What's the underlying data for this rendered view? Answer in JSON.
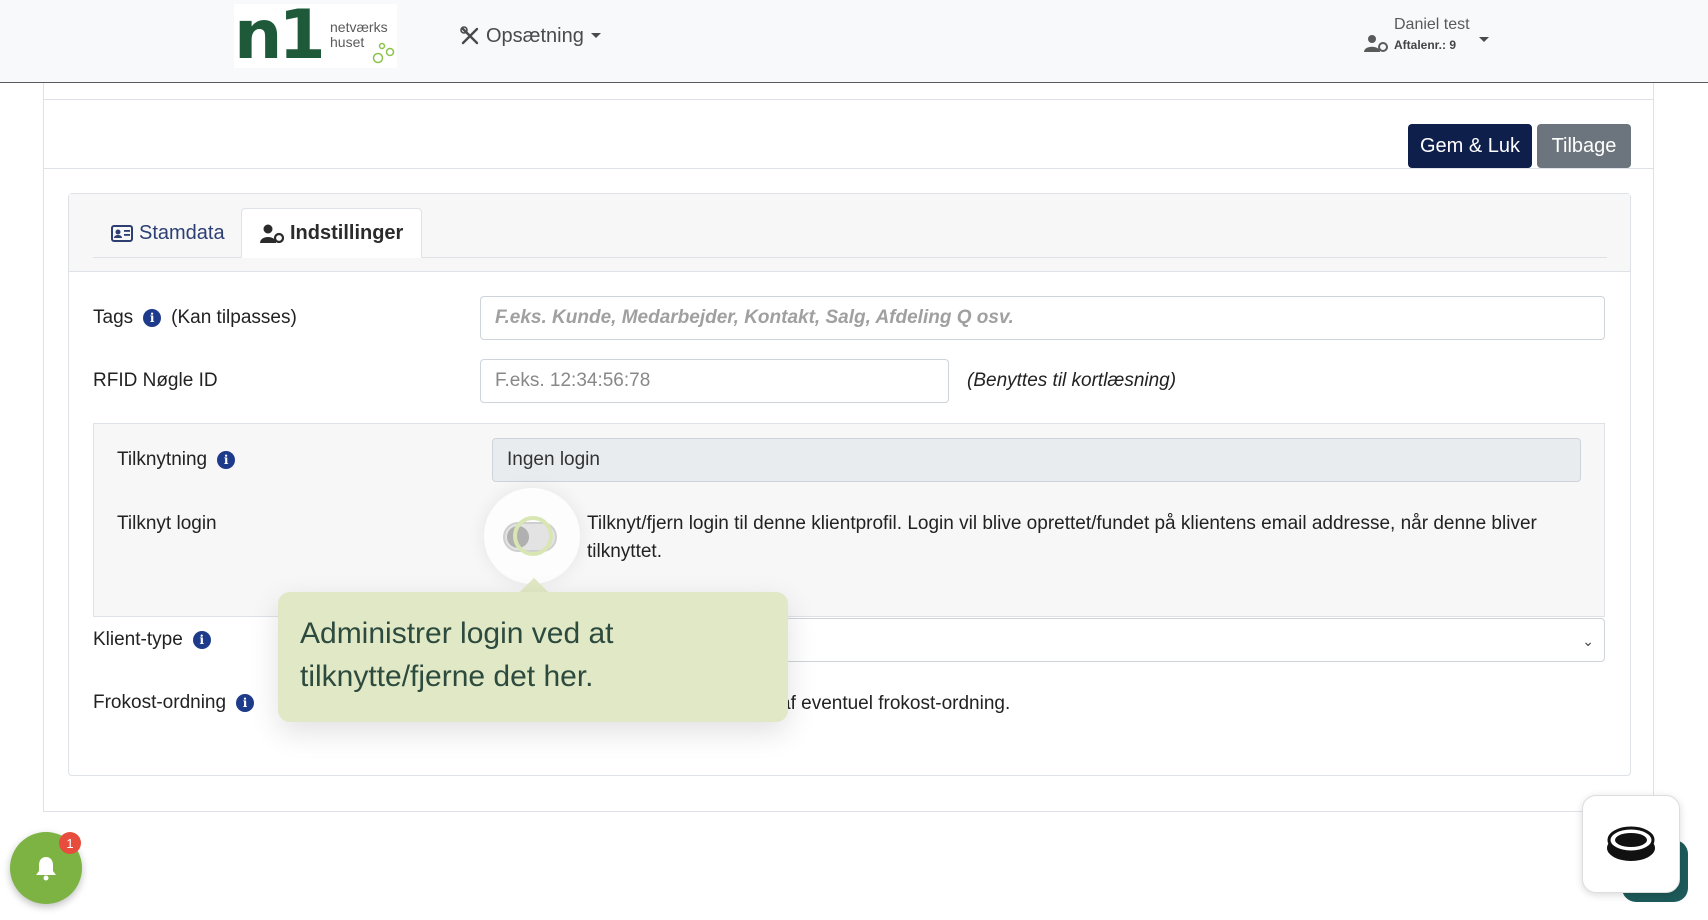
{
  "navbar": {
    "logo_text_line1": "netværks",
    "logo_text_line2": "huset",
    "logo_mark": "n1",
    "setup_menu_label": "Opsætning",
    "user_name": "Daniel test",
    "agreement_label": "Aftalenr.:",
    "agreement_number": "9"
  },
  "toolbar": {
    "save_close_label": "Gem & Luk",
    "back_label": "Tilbage"
  },
  "tabs": [
    {
      "label": "Stamdata",
      "icon": "id-card-icon",
      "active": false
    },
    {
      "label": "Indstillinger",
      "icon": "user-gear-icon",
      "active": true
    }
  ],
  "form": {
    "tags": {
      "label": "Tags",
      "sublabel": "(Kan tilpasses)",
      "placeholder": "F.eks. Kunde, Medarbejder, Kontakt, Salg, Afdeling Q osv."
    },
    "rfid": {
      "label": "RFID Nøgle ID",
      "placeholder": "F.eks. 12:34:56:78",
      "hint": "(Benyttes til kortlæsning)"
    },
    "tilknytning": {
      "label": "Tilknytning",
      "value": "Ingen login"
    },
    "tilknyt_login": {
      "label": "Tilknyt login",
      "description": "Tilknyt/fjern login til denne klientprofil. Login vil blive oprettet/fundet på klientens email addresse, når denne bliver tilknyttet.",
      "enabled": false
    },
    "klient_type": {
      "label": "Klient-type",
      "value": ""
    },
    "frokost": {
      "label": "Frokost-ordning",
      "description_visible": "af eventuel frokost-ordning."
    }
  },
  "tooltip": {
    "text": "Administrer login ved at tilknytte/fjerne det her."
  },
  "notifications": {
    "badge_count": "1"
  },
  "colors": {
    "primary": "#0f1f4b",
    "secondary": "#6c757d",
    "tooltip_bg": "#e0e8c5",
    "bell_bg": "#7cb342",
    "badge": "#e74c3c",
    "info_icon": "#1e3a8a"
  }
}
